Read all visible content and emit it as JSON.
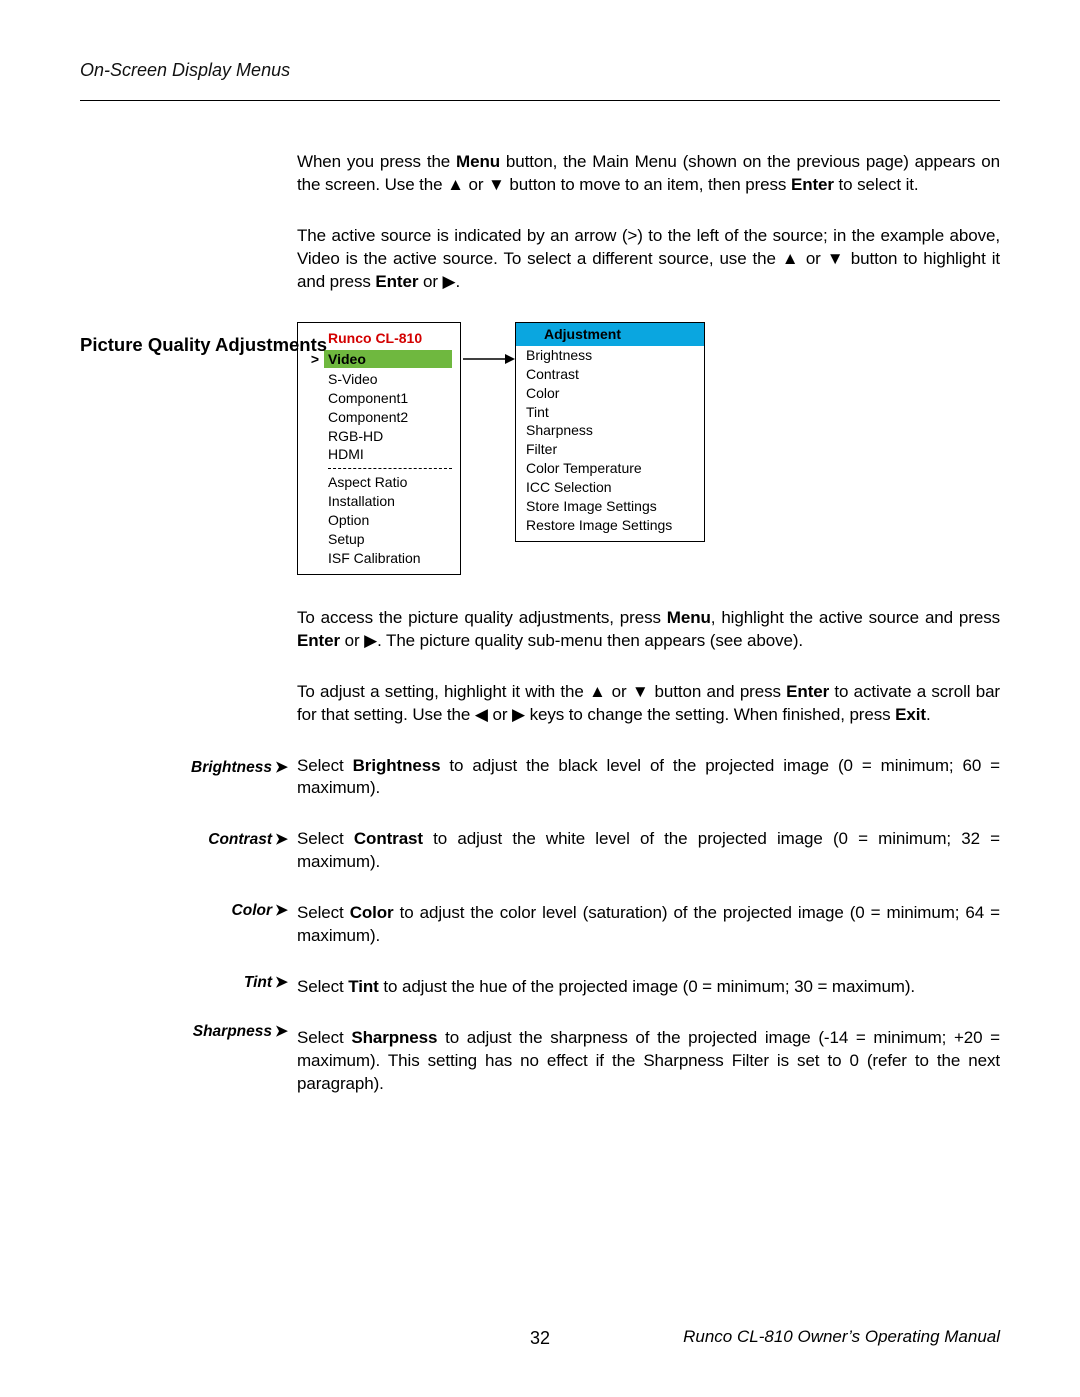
{
  "header": "On-Screen Display Menus",
  "section_heading": "Picture Quality Adjustments",
  "intro1": {
    "pre": "When you press the ",
    "b1": "Menu",
    "mid1": " button, the Main Menu (shown on the previous page) appears on the screen. Use the ▲ or ▼ button to move to an item, then press ",
    "b2": "Enter",
    "post": " to select it."
  },
  "intro2": {
    "pre": "The active source is indicated by an arrow (>) to the left of the source; in the example above, Video is the active source. To select a different source, use the ▲ or ▼ button to highlight it and press ",
    "b1": "Enter",
    "mid1": " or ▶."
  },
  "menu_left": {
    "title": "Runco CL-810",
    "active": "Video",
    "sources": [
      "S-Video",
      "Component1",
      "Component2",
      "RGB-HD",
      "HDMI"
    ],
    "below": [
      "Aspect Ratio",
      "Installation",
      "Option",
      "Setup",
      "ISF Calibration"
    ]
  },
  "menu_right": {
    "header": "Adjustment",
    "items": [
      "Brightness",
      "Contrast",
      "Color",
      "Tint",
      "Sharpness",
      "Filter",
      "Color Temperature",
      "ICC Selection",
      "Store Image Settings",
      "Restore Image Settings"
    ]
  },
  "para_access": {
    "pre": "To access the picture quality adjustments, press ",
    "b1": "Menu",
    "mid1": ", highlight the active source and press ",
    "b2": "Enter",
    "mid2": " or ▶. The picture quality sub-menu then appears (see above)."
  },
  "para_adjust": {
    "pre": "To adjust a setting, highlight it with the ▲ or ▼ button and press ",
    "b1": "Enter",
    "mid1": " to activate a scroll bar for that setting. Use the ◀ or ▶ keys to change the setting. When finished, press ",
    "b2": "Exit",
    "post": "."
  },
  "labels": {
    "brightness": "Brightness",
    "contrast": "Contrast",
    "color": "Color",
    "tint": "Tint",
    "sharpness": "Sharpness"
  },
  "desc_brightness": {
    "pre": "Select ",
    "b1": "Brightness",
    "post": " to adjust the black level of the projected image (0 = minimum; 60 = maximum)."
  },
  "desc_contrast": {
    "pre": "Select ",
    "b1": "Contrast",
    "post": " to adjust the white level of the projected image (0 = minimum; 32 = maximum)."
  },
  "desc_color": {
    "pre": "Select ",
    "b1": "Color",
    "post": " to adjust the color level (saturation) of the projected image (0 = minimum; 64 = maximum)."
  },
  "desc_tint": {
    "pre": "Select ",
    "b1": "Tint",
    "post": " to adjust the hue of the projected image (0 = minimum; 30 = maximum)."
  },
  "desc_sharpness": {
    "pre": "Select ",
    "b1": "Sharpness",
    "post": " to adjust the sharpness of the projected image (-14 = minimum; +20 = maximum). This setting has no effect if the Sharpness Filter is set to 0 (refer to the next paragraph)."
  },
  "footer": {
    "page": "32",
    "manual": "Runco CL-810 Owner’s Operating Manual"
  }
}
